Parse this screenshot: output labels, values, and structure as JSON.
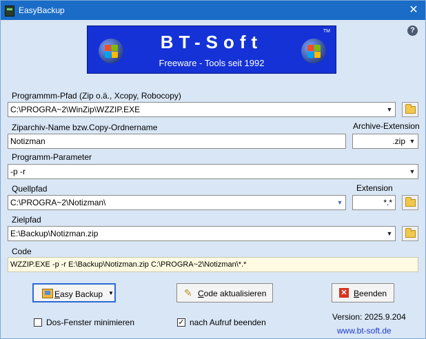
{
  "window": {
    "title": "EasyBackup",
    "close_glyph": "✕"
  },
  "banner": {
    "brand": "BT-Soft",
    "trademark": "TM",
    "tagline": "Freeware - Tools seit 1992",
    "logo_icon": "windows-flag-icon"
  },
  "help": {
    "glyph": "?"
  },
  "program_path": {
    "label": "Programmm-Pfad (Zip o.ä., Xcopy, Robocopy)",
    "value": "C:\\PROGRA~2\\WinZip\\WZZIP.EXE"
  },
  "archive_name": {
    "label": "Ziparchiv-Name bzw.Copy-Ordnername",
    "value": "Notizman"
  },
  "archive_extension": {
    "label": "Archive-Extension",
    "value": ".zip"
  },
  "program_params": {
    "label": "Programm-Parameter",
    "value": "-p -r"
  },
  "source_path": {
    "label": "Quellpfad",
    "value": "C:\\PROGRA~2\\Notizman\\"
  },
  "extension": {
    "label": "Extension",
    "value": "*.*"
  },
  "target_path": {
    "label": "Zielpfad",
    "value": "E:\\Backup\\Notizman.zip"
  },
  "code": {
    "label": "Code",
    "value": "WZZIP.EXE -p -r E:\\Backup\\Notizman.zip C:\\PROGRA~2\\Notizman\\*.*"
  },
  "buttons": {
    "easy_backup": "Easy Backup",
    "update_code": "Code aktualisieren",
    "quit": "Beenden"
  },
  "options": {
    "minimize_dos": {
      "label": "Dos-Fenster minimieren",
      "checked": false
    },
    "quit_after_run": {
      "label": "nach Aufruf beenden",
      "checked": true,
      "mark": "✓"
    }
  },
  "footer": {
    "version": "Version: 2025.9.204",
    "url": "www.bt-soft.de"
  },
  "colors": {
    "titlebar": "#1a6cc7",
    "window_bg": "#d9e6f5",
    "banner_bg": "#1432d6",
    "code_bg": "#fffbe2",
    "link": "#1a3ad0"
  }
}
